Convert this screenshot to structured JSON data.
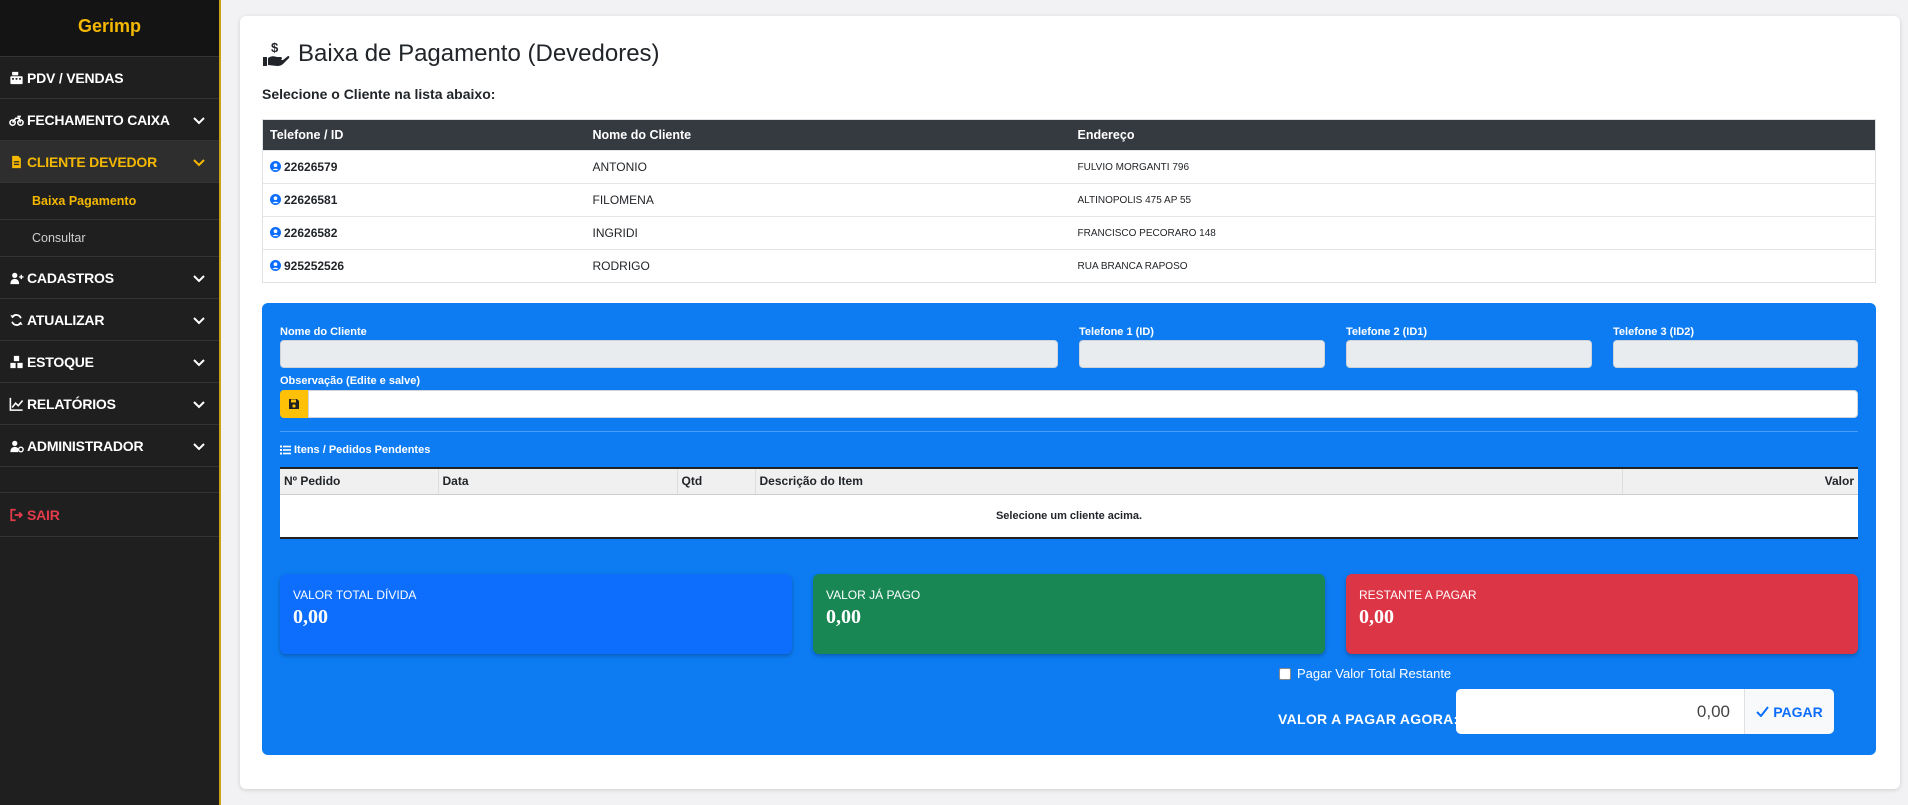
{
  "app": {
    "brand": "Gerimp"
  },
  "sidebar": {
    "items": [
      {
        "label": "PDV / VENDAS",
        "icon": "cash-register-icon"
      },
      {
        "label": "FECHAMENTO CAIXA",
        "icon": "motorcycle-icon"
      },
      {
        "label": "CLIENTE DEVEDOR",
        "icon": "file-invoice-icon"
      },
      {
        "label": "CADASTROS",
        "icon": "user-plus-icon"
      },
      {
        "label": "ATUALIZAR",
        "icon": "sync-icon"
      },
      {
        "label": "ESTOQUE",
        "icon": "boxes-icon"
      },
      {
        "label": "RELATÓRIOS",
        "icon": "chart-line-icon"
      },
      {
        "label": "ADMINISTRADOR",
        "icon": "user-cog-icon"
      }
    ],
    "subitems": [
      {
        "label": "Baixa Pagamento"
      },
      {
        "label": "Consultar"
      }
    ],
    "logout": "SAIR"
  },
  "page": {
    "title": "Baixa de Pagamento (Devedores)",
    "subtitle": "Selecione o Cliente na lista abaixo:"
  },
  "clients": {
    "headers": [
      "Telefone / ID",
      "Nome do Cliente",
      "Endereço"
    ],
    "rows": [
      {
        "phone": "22626579",
        "name": "ANTONIO",
        "address": "FULVIO MORGANTI 796"
      },
      {
        "phone": "22626581",
        "name": "FILOMENA",
        "address": "ALTINOPOLIS 475 AP 55"
      },
      {
        "phone": "22626582",
        "name": "INGRIDI",
        "address": "FRANCISCO PECORARO 148"
      },
      {
        "phone": "925252526",
        "name": "RODRIGO",
        "address": "RUA BRANCA RAPOSO"
      }
    ]
  },
  "form": {
    "name_label": "Nome do Cliente",
    "tel1_label": "Telefone 1 (ID)",
    "tel2_label": "Telefone 2 (ID1)",
    "tel3_label": "Telefone 3 (ID2)",
    "obs_label": "Observação (Edite e salve)"
  },
  "items": {
    "title": "Itens / Pedidos Pendentes",
    "headers": [
      "Nº Pedido",
      "Data",
      "Qtd",
      "Descrição do Item",
      "Valor"
    ],
    "empty": "Selecione um cliente acima."
  },
  "summary": {
    "total_label": "VALOR TOTAL DÍVIDA",
    "total_value": "0,00",
    "paid_label": "VALOR JÁ PAGO",
    "paid_value": "0,00",
    "remaining_label": "RESTANTE A PAGAR",
    "remaining_value": "0,00"
  },
  "payment": {
    "checkbox_label": "Pagar Valor Total Restante",
    "amount_label": "VALOR A PAGAR AGORA:",
    "amount_value": "0,00",
    "button_label": "PAGAR"
  },
  "colors": {
    "brand": "#f5b800",
    "panel": "#0d7cf2",
    "total": "#0d6efd",
    "paid": "#198754",
    "remaining": "#dc3545",
    "logout": "#e33b4a"
  }
}
